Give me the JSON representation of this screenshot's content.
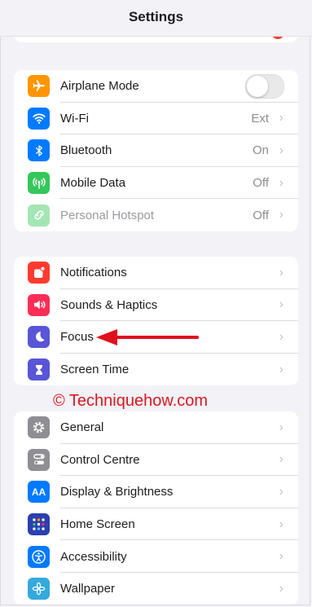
{
  "header": {
    "title": "Settings"
  },
  "group1": {
    "items": [
      {
        "label": "Airplane Mode",
        "icon": "airplane-icon",
        "color": "#ff9500",
        "toggle": false
      },
      {
        "label": "Wi-Fi",
        "value": "Ext",
        "icon": "wifi-icon",
        "color": "#007aff"
      },
      {
        "label": "Bluetooth",
        "value": "On",
        "icon": "bluetooth-icon",
        "color": "#007aff"
      },
      {
        "label": "Mobile Data",
        "value": "Off",
        "icon": "antenna-icon",
        "color": "#34c759"
      },
      {
        "label": "Personal Hotspot",
        "value": "Off",
        "icon": "hotspot-icon",
        "color": "#34c759",
        "disabled": true
      }
    ]
  },
  "group2": {
    "items": [
      {
        "label": "Notifications",
        "icon": "bell-icon",
        "color": "#ff3b30"
      },
      {
        "label": "Sounds & Haptics",
        "icon": "speaker-icon",
        "color": "#ff2d55"
      },
      {
        "label": "Focus",
        "icon": "moon-icon",
        "color": "#5856d6"
      },
      {
        "label": "Screen Time",
        "icon": "hourglass-icon",
        "color": "#5856d6"
      }
    ]
  },
  "group3": {
    "items": [
      {
        "label": "General",
        "icon": "gear-icon",
        "color": "#8e8e93"
      },
      {
        "label": "Control Centre",
        "icon": "switches-icon",
        "color": "#8e8e93"
      },
      {
        "label": "Display & Brightness",
        "icon": "display-icon",
        "color": "#007aff"
      },
      {
        "label": "Home Screen",
        "icon": "grid-icon",
        "color": "#2c3fb0"
      },
      {
        "label": "Accessibility",
        "icon": "accessibility-icon",
        "color": "#007aff"
      },
      {
        "label": "Wallpaper",
        "icon": "flower-icon",
        "color": "#34aadc"
      }
    ]
  },
  "watermark": "© Techniquehow.com",
  "annotation": {
    "arrow_color": "#e0101c",
    "target": "Focus"
  }
}
